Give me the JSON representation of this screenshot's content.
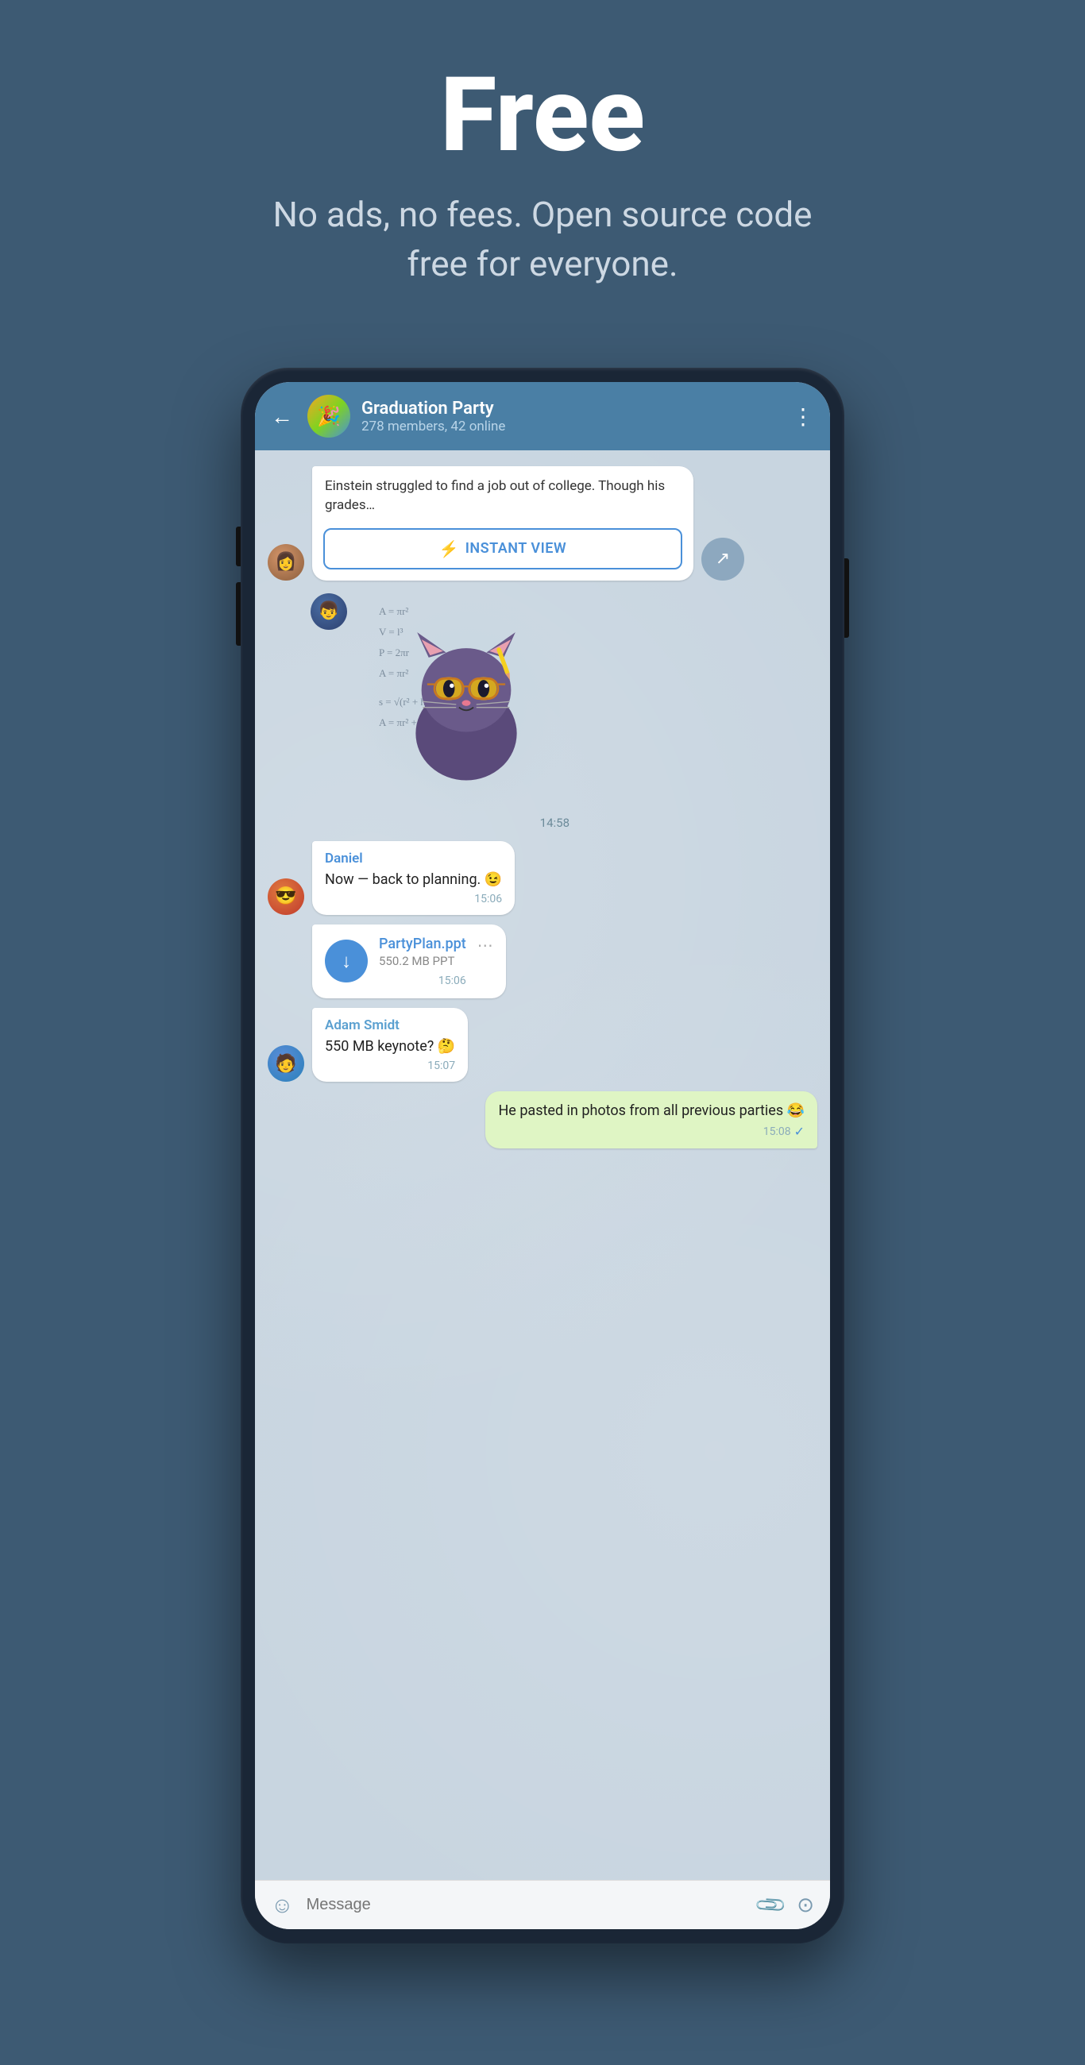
{
  "hero": {
    "title": "Free",
    "subtitle": "No ads, no fees. Open source code free for everyone."
  },
  "chat": {
    "back_label": "←",
    "group_name": "Graduation Party",
    "group_members": "278 members, 42 online",
    "menu_icon": "⋮",
    "messages": [
      {
        "id": "msg1",
        "type": "instant_view",
        "sender": "girl",
        "text": "Einstein struggled to find a job out of college. Though his grades…",
        "button_label": "INSTANT VIEW",
        "time": ""
      },
      {
        "id": "msg2",
        "type": "sticker",
        "sender": "guy1",
        "time": "14:58"
      },
      {
        "id": "msg3",
        "type": "text",
        "sender": "guy2",
        "sender_name": "Daniel",
        "text": "Now — back to planning. 😉",
        "time": "15:06"
      },
      {
        "id": "msg4",
        "type": "file",
        "sender": "guy2",
        "file_name": "PartyPlan.ppt",
        "file_size": "550.2 MB PPT",
        "time": "15:06"
      },
      {
        "id": "msg5",
        "type": "text",
        "sender": "guy3",
        "sender_name": "Adam Smidt",
        "text": "550 MB keynote? 🤔",
        "time": "15:07"
      },
      {
        "id": "msg6",
        "type": "text_outgoing",
        "text": "He pasted in photos from all previous parties 😂",
        "time": "15:08"
      }
    ],
    "input_placeholder": "Message",
    "lightning_icon": "⚡"
  },
  "colors": {
    "bg": "#3d5a73",
    "header": "#4a7fa5",
    "accent": "#4a90d9",
    "outgoing_bubble": "#dff5c4",
    "incoming_bubble": "#ffffff"
  }
}
